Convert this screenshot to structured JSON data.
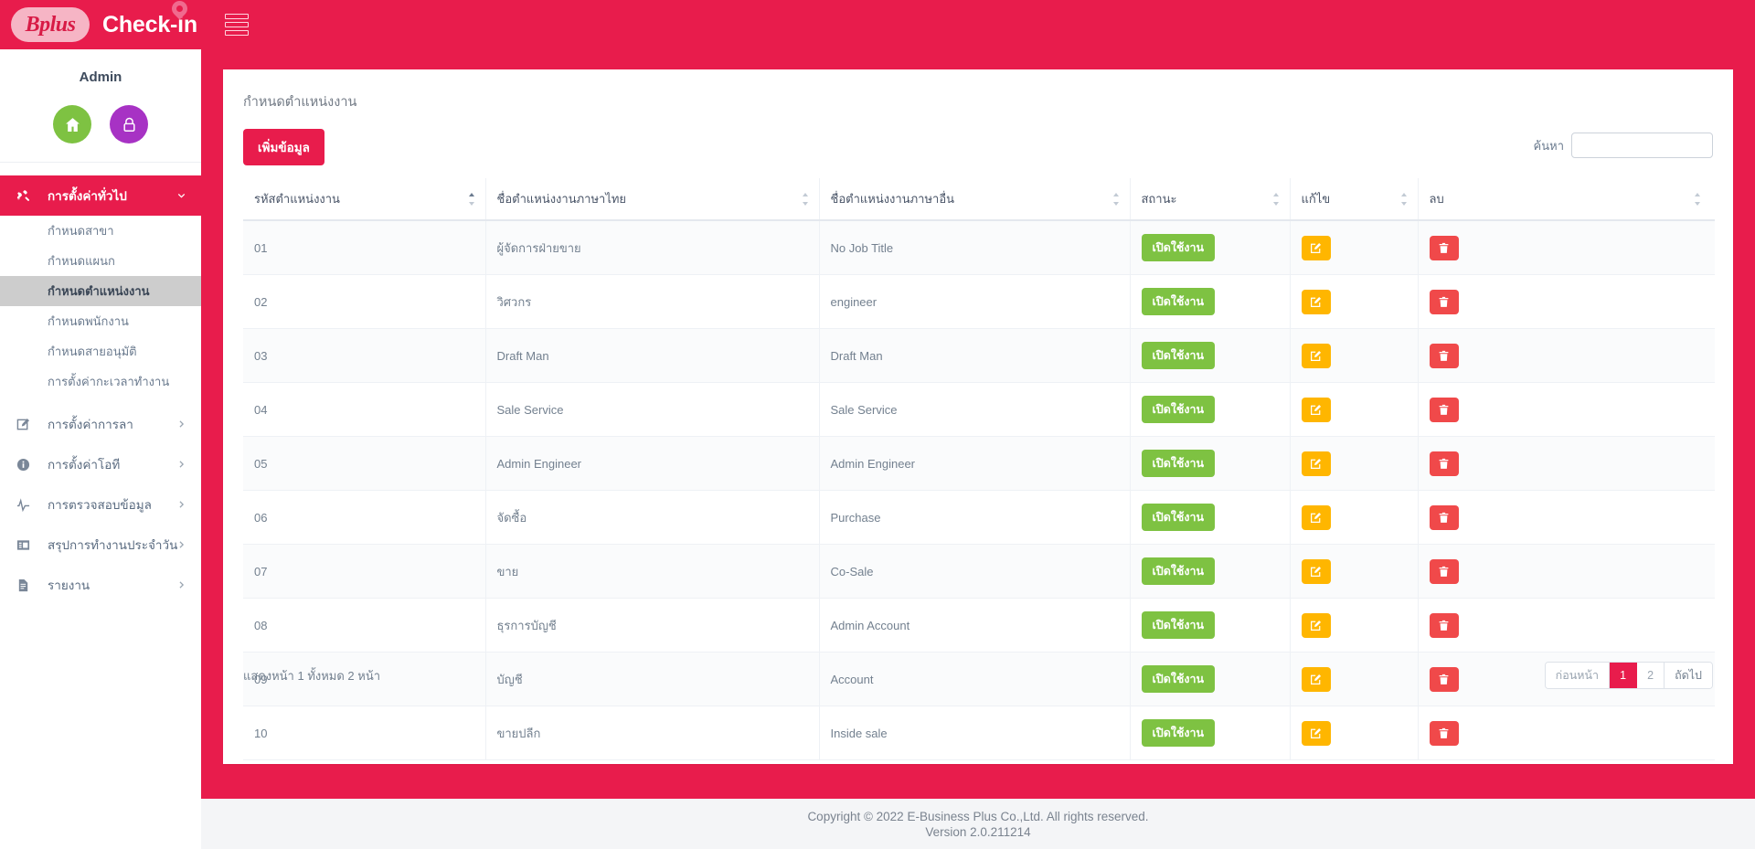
{
  "brand": {
    "logo_text": "Bplus",
    "app_name": "Check-in",
    "logo_icon": "map-pin-icon",
    "menu_icon": "hamburger-menu-icon"
  },
  "sidebar": {
    "user_name": "Admin",
    "home_icon": "home-icon",
    "lock_icon": "lock-icon",
    "groups": [
      {
        "label": "การตั้งค่าทั่วไป",
        "icon": "tools-icon",
        "active": true,
        "caret": "chevron-down-icon",
        "items": [
          {
            "label": "กำหนดสาขา",
            "current": false
          },
          {
            "label": "กำหนดแผนก",
            "current": false
          },
          {
            "label": "กำหนดตำแหน่งงาน",
            "current": true
          },
          {
            "label": "กำหนดพนักงาน",
            "current": false
          },
          {
            "label": "กำหนดสายอนุมัติ",
            "current": false
          },
          {
            "label": "การตั้งค่ากะเวลาทำงาน",
            "current": false
          }
        ]
      },
      {
        "label": "การตั้งค่าการลา",
        "icon": "edit-square-icon",
        "active": false,
        "caret": "chevron-right-icon",
        "items": []
      },
      {
        "label": "การตั้งค่าโอที",
        "icon": "info-circle-icon",
        "active": false,
        "caret": "chevron-right-icon",
        "items": []
      },
      {
        "label": "การตรวจสอบข้อมูล",
        "icon": "pulse-icon",
        "active": false,
        "caret": "chevron-right-icon",
        "items": []
      },
      {
        "label": "สรุปการทำงานประจำวัน",
        "icon": "list-panel-icon",
        "active": false,
        "caret": "chevron-right-icon",
        "items": []
      },
      {
        "label": "รายงาน",
        "icon": "document-icon",
        "active": false,
        "caret": "chevron-right-icon",
        "items": []
      }
    ]
  },
  "main": {
    "page_title": "กำหนดตำแหน่งงาน",
    "add_button_label": "เพิ่มข้อมูล",
    "search": {
      "label": "ค้นหา",
      "value": "",
      "placeholder": ""
    },
    "table": {
      "sort_icon": "sort-arrows-icon",
      "columns": [
        {
          "label": "รหัสตำแหน่งงาน",
          "sorted": "asc"
        },
        {
          "label": "ชื่อตำแหน่งงานภาษาไทย",
          "sorted": "none"
        },
        {
          "label": "ชื่อตำแหน่งงานภาษาอื่น",
          "sorted": "none"
        },
        {
          "label": "สถานะ",
          "sorted": "none"
        },
        {
          "label": "แก้ไข",
          "sorted": "none"
        },
        {
          "label": "ลบ",
          "sorted": "none"
        }
      ],
      "edit_icon": "pencil-square-icon",
      "delete_icon": "trash-icon",
      "rows": [
        {
          "code": "01",
          "name_th": "ผู้จัดการฝ่ายขาย",
          "name_other": "No Job Title",
          "status": "เปิดใช้งาน"
        },
        {
          "code": "02",
          "name_th": "วิศวกร",
          "name_other": "engineer",
          "status": "เปิดใช้งาน"
        },
        {
          "code": "03",
          "name_th": "Draft Man",
          "name_other": "Draft Man",
          "status": "เปิดใช้งาน"
        },
        {
          "code": "04",
          "name_th": "Sale Service",
          "name_other": "Sale Service",
          "status": "เปิดใช้งาน"
        },
        {
          "code": "05",
          "name_th": "Admin Engineer",
          "name_other": "Admin Engineer",
          "status": "เปิดใช้งาน"
        },
        {
          "code": "06",
          "name_th": "จัดซื้อ",
          "name_other": "Purchase",
          "status": "เปิดใช้งาน"
        },
        {
          "code": "07",
          "name_th": "ขาย",
          "name_other": "Co-Sale",
          "status": "เปิดใช้งาน"
        },
        {
          "code": "08",
          "name_th": "ธุรการบัญชี",
          "name_other": "Admin Account",
          "status": "เปิดใช้งาน"
        },
        {
          "code": "09",
          "name_th": "บัญชี",
          "name_other": "Account",
          "status": "เปิดใช้งาน"
        },
        {
          "code": "10",
          "name_th": "ขายปลีก",
          "name_other": "Inside sale",
          "status": "เปิดใช้งาน"
        }
      ]
    },
    "pagination": {
      "info": "แสดงหน้า 1 ทั้งหมด 2 หน้า",
      "prev_label": "ก่อนหน้า",
      "next_label": "ถัดไป",
      "pages": [
        "1",
        "2"
      ],
      "current_page": "1"
    }
  },
  "footer": {
    "copyright": "Copyright © 2022 E-Business Plus Co.,Ltd. All rights reserved.",
    "version": "Version 2.0.211214"
  },
  "colors": {
    "brand_red": "#e81c4c",
    "status_green": "#7ec242",
    "edit_yellow": "#ffb600",
    "delete_red": "#f0494a",
    "purple": "#a732c4"
  }
}
